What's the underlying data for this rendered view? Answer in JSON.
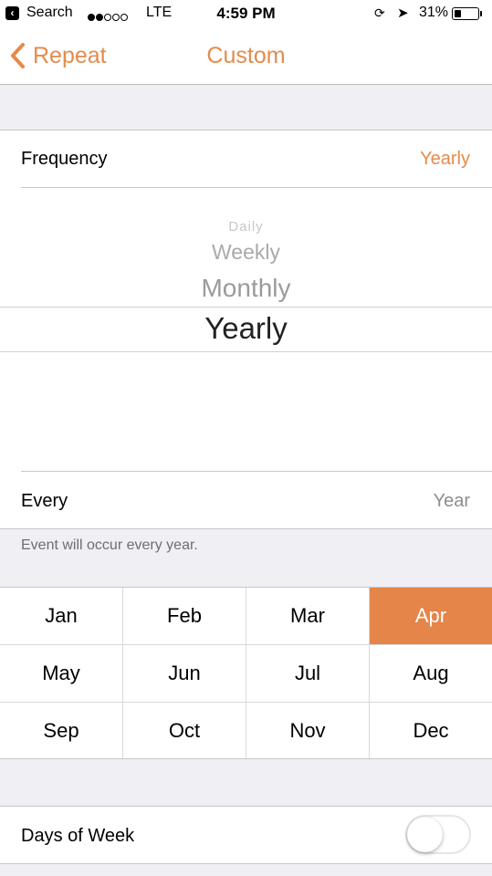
{
  "status_bar": {
    "back_app": "Search",
    "carrier": "LTE",
    "time": "4:59 PM",
    "battery_pct": "31%",
    "battery_level": 0.31,
    "signal_bars_filled": 2,
    "signal_bars_total": 5
  },
  "nav": {
    "back_label": "Repeat",
    "title": "Custom"
  },
  "frequency": {
    "label": "Frequency",
    "value": "Yearly"
  },
  "picker": {
    "options": [
      "Daily",
      "Weekly",
      "Monthly",
      "Yearly"
    ],
    "selected": "Yearly"
  },
  "every": {
    "label": "Every",
    "value": "Year"
  },
  "footer_note": "Event will occur every year.",
  "months": {
    "items": [
      "Jan",
      "Feb",
      "Mar",
      "Apr",
      "May",
      "Jun",
      "Jul",
      "Aug",
      "Sep",
      "Oct",
      "Nov",
      "Dec"
    ],
    "selected": "Apr"
  },
  "days_of_week": {
    "label": "Days of Week",
    "enabled": false
  },
  "colors": {
    "accent": "#e58a4b",
    "selected_month_bg": "#e5854a",
    "group_background": "#efeff4",
    "secondary_text": "#8e8e93"
  }
}
